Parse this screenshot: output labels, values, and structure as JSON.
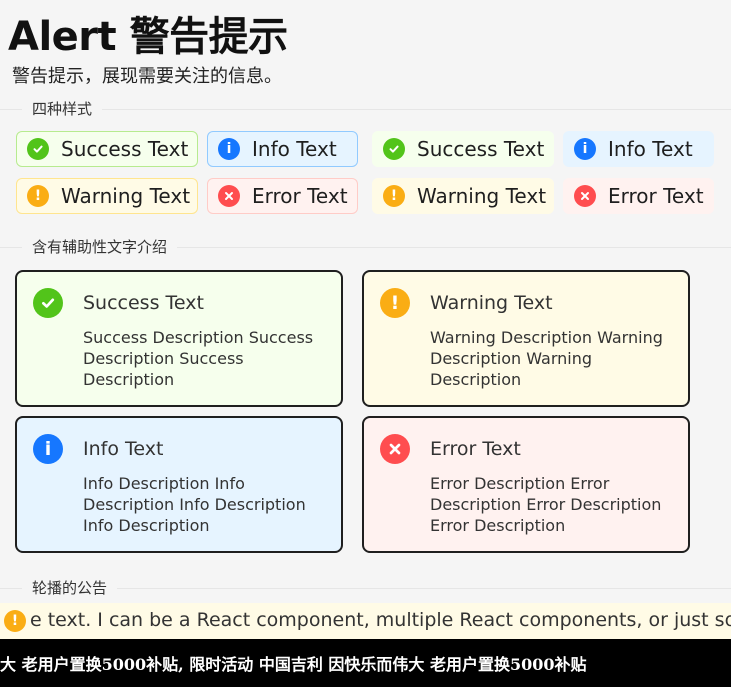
{
  "header": {
    "title": "Alert 警告提示",
    "subtitle": "警告提示，展现需要关注的信息。"
  },
  "sections": {
    "four_styles": "四种样式",
    "with_description": "含有辅助性文字介绍",
    "carousel_notice": "轮播的公告"
  },
  "basic_alerts": [
    {
      "type": "success",
      "text": "Success Text",
      "bordered": true
    },
    {
      "type": "info",
      "text": "Info Text",
      "bordered": true
    },
    {
      "type": "success",
      "text": "Success Text",
      "bordered": false
    },
    {
      "type": "info",
      "text": "Info Text",
      "bordered": false
    },
    {
      "type": "warning",
      "text": "Warning Text",
      "bordered": true
    },
    {
      "type": "error",
      "text": "Error Text",
      "bordered": true
    },
    {
      "type": "warning",
      "text": "Warning Text",
      "bordered": false
    },
    {
      "type": "error",
      "text": "Error Text",
      "bordered": false
    }
  ],
  "description_alerts": [
    {
      "type": "success",
      "message": "Success Text",
      "description": "Success Description Success Description Success Description"
    },
    {
      "type": "warning",
      "message": "Warning Text",
      "description": "Warning Description Warning Description Warning Description"
    },
    {
      "type": "info",
      "message": "Info Text",
      "description": "Info Description Info Description Info Description Info Description"
    },
    {
      "type": "error",
      "message": "Error Text",
      "description": "Error Description Error Description Error Description Error Description"
    }
  ],
  "marquee": {
    "icon": "exclamation-icon",
    "text": "e text.    I can be a React component, multiple React components, or just some"
  },
  "ticker": {
    "text": "大 老用户置换5000补贴, 限时活动 中国吉利 因快乐而伟大 老用户置换5000补贴"
  },
  "colors": {
    "success": "#52c41a",
    "info": "#1677ff",
    "warning": "#faad14",
    "error": "#ff4d4f"
  }
}
